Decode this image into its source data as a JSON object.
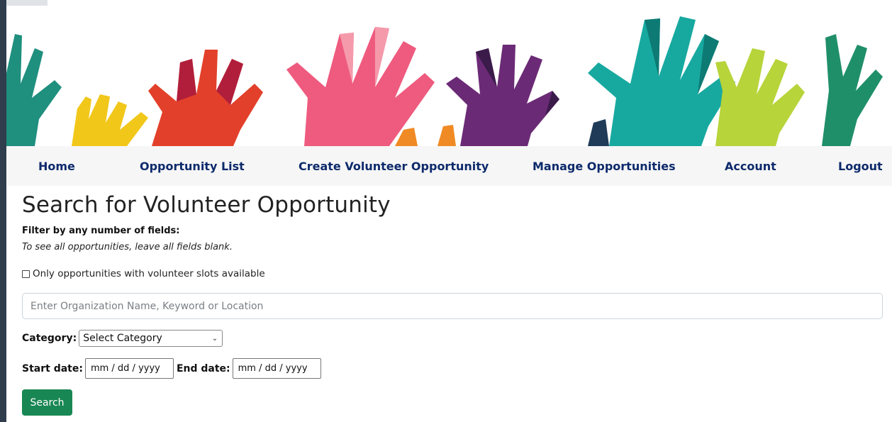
{
  "nav": {
    "items": [
      {
        "label": "Home"
      },
      {
        "label": "Opportunity List"
      },
      {
        "label": "Create Volunteer Opportunity"
      },
      {
        "label": "Manage Opportunities"
      },
      {
        "label": "Account"
      },
      {
        "label": "Logout"
      }
    ]
  },
  "search_form": {
    "title": "Search for Volunteer Opportunity",
    "filter_label": "Filter by any number of fields:",
    "filter_hint": "To see all opportunities, leave all fields blank.",
    "slots_checkbox_label": "Only opportunities with volunteer slots available",
    "slots_checked": false,
    "keyword_placeholder": "Enter Organization Name, Keyword or Location",
    "keyword_value": "",
    "category_label": "Category:",
    "category_selected": "Select Category",
    "start_date_label": "Start date:",
    "start_date_placeholder": "mm / dd / yyyy",
    "end_date_label": "End date:",
    "end_date_placeholder": "mm / dd / yyyy",
    "search_button": "Search"
  },
  "colors": {
    "nav_text": "#0d2a6b",
    "nav_background": "#f6f6f6",
    "search_button": "#198754",
    "frame": "#2f3d4d"
  },
  "icons": {
    "dropdown": "chevron-down-icon",
    "banner": "raised-hands-illustration"
  }
}
